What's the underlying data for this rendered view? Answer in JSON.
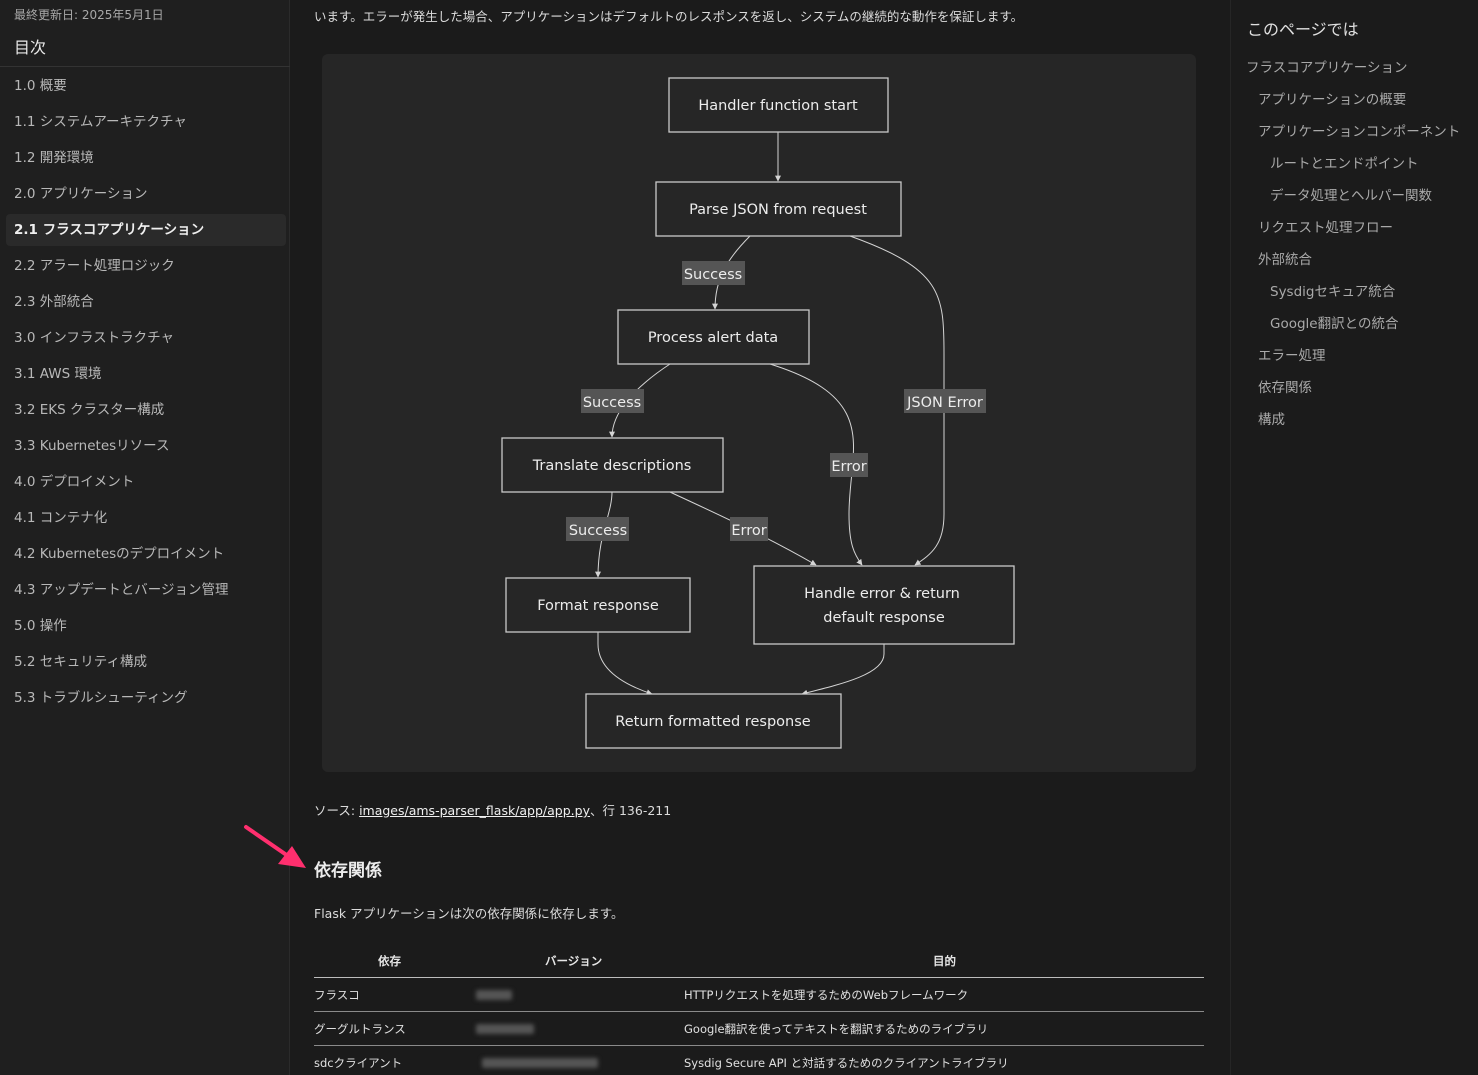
{
  "sidebar": {
    "updated": "最終更新日: 2025年5月1日",
    "title": "目次",
    "items": [
      {
        "label": "1.0 概要"
      },
      {
        "label": "1.1 システムアーキテクチャ"
      },
      {
        "label": "1.2 開発環境"
      },
      {
        "label": "2.0 アプリケーション"
      },
      {
        "label": "2.1 フラスコアプリケーション",
        "active": true
      },
      {
        "label": "2.2 アラート処理ロジック"
      },
      {
        "label": "2.3 外部統合"
      },
      {
        "label": "3.0 インフラストラクチャ"
      },
      {
        "label": "3.1 AWS 環境"
      },
      {
        "label": "3.2 EKS クラスター構成"
      },
      {
        "label": "3.3 Kubernetesリソース"
      },
      {
        "label": "4.0 デプロイメント"
      },
      {
        "label": "4.1 コンテナ化"
      },
      {
        "label": "4.2 Kubernetesのデプロイメント"
      },
      {
        "label": "4.3 アップデートとバージョン管理"
      },
      {
        "label": "5.0 操作"
      },
      {
        "label": "5.2 セキュリティ構成"
      },
      {
        "label": "5.3 トラブルシューティング"
      }
    ]
  },
  "main": {
    "intro": "います。エラーが発生した場合、アプリケーションはデフォルトのレスポンスを返し、システムの継続的な動作を保証します。",
    "diagram": {
      "nodes": {
        "start": "Handler function start",
        "parse": "Parse JSON from request",
        "process": "Process alert data",
        "translate": "Translate descriptions",
        "format": "Format response",
        "handle_error_1": "Handle error & return",
        "handle_error_2": "default response",
        "return": "Return formatted response"
      },
      "edge_labels": {
        "parse_success": "Success",
        "process_success": "Success",
        "translate_success": "Success",
        "translate_error": "Error",
        "process_error": "Error",
        "json_error": "JSON Error"
      }
    },
    "source_prefix": "ソース: ",
    "source_link": "images/ams-parser_flask/app/app.py",
    "source_suffix": "、行 136-211",
    "section_heading": "依存関係",
    "section_desc": "Flask アプリケーションは次の依存関係に依存します。",
    "table": {
      "headers": [
        "依存",
        "バージョン",
        "目的"
      ],
      "rows": [
        {
          "dependency": "フラスコ",
          "purpose": "HTTPリクエストを処理するためのWebフレームワーク"
        },
        {
          "dependency": "グーグルトランス",
          "purpose": "Google翻訳を使ってテキストを翻訳するためのライブラリ"
        },
        {
          "dependency": "sdcクライアント",
          "purpose": "Sysdig Secure API と対話するためのクライアントライブラリ"
        }
      ]
    }
  },
  "right_toc": {
    "title": "このページでは",
    "items": [
      {
        "label": "フラスコアプリケーション",
        "level": 0
      },
      {
        "label": "アプリケーションの概要",
        "level": 1
      },
      {
        "label": "アプリケーションコンポーネント",
        "level": 1
      },
      {
        "label": "ルートとエンドポイント",
        "level": 2
      },
      {
        "label": "データ処理とヘルパー関数",
        "level": 2
      },
      {
        "label": "リクエスト処理フロー",
        "level": 1
      },
      {
        "label": "外部統合",
        "level": 1
      },
      {
        "label": "Sysdigセキュア統合",
        "level": 2
      },
      {
        "label": "Google翻訳との統合",
        "level": 2
      },
      {
        "label": "エラー処理",
        "level": 1
      },
      {
        "label": "依存関係",
        "level": 1
      },
      {
        "label": "構成",
        "level": 1
      }
    ]
  },
  "colors": {
    "background": "#1b1b1b",
    "annotation_arrow": "#ff2f6e",
    "edge_label_bg": "#555555"
  }
}
